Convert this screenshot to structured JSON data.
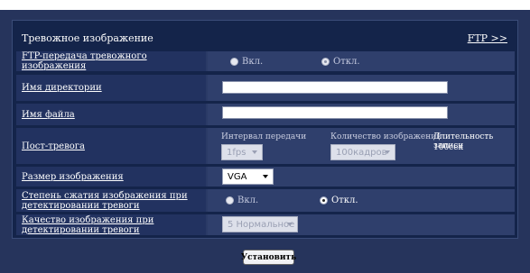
{
  "header": {
    "title": "Тревожное изображение",
    "ftp_link": "FTP >>"
  },
  "rows": {
    "ftp_transfer": {
      "label": "FTP-передача тревожного изображения",
      "on_label": "Вкл.",
      "off_label": "Откл.",
      "selected": "off"
    },
    "dir_name": {
      "label": "Имя директории",
      "value": ""
    },
    "file_name": {
      "label": "Имя файла",
      "value": ""
    },
    "post_alarm": {
      "label": "Пост-тревога",
      "interval_label": "Интервал передачи",
      "interval_value": "1fps",
      "count_label": "Количество изображений",
      "count_value": "100кадров",
      "duration_label": "Длительность записи",
      "duration_value": "100сек"
    },
    "image_size": {
      "label": "Размер изображения",
      "value": "VGA"
    },
    "compression": {
      "label": "Степень сжатия изображения при детектировании тревоги",
      "on_label": "Вкл.",
      "off_label": "Откл.",
      "selected": "off"
    },
    "quality": {
      "label": "Качество изображения при детектировании тревоги",
      "value": "5 Нормальное"
    }
  },
  "buttons": {
    "set_label": "Установить"
  },
  "colors": {
    "background": "#26345c",
    "panel": "#14244a",
    "label_cell": "#223260",
    "value_cell": "#2f3f6c"
  }
}
